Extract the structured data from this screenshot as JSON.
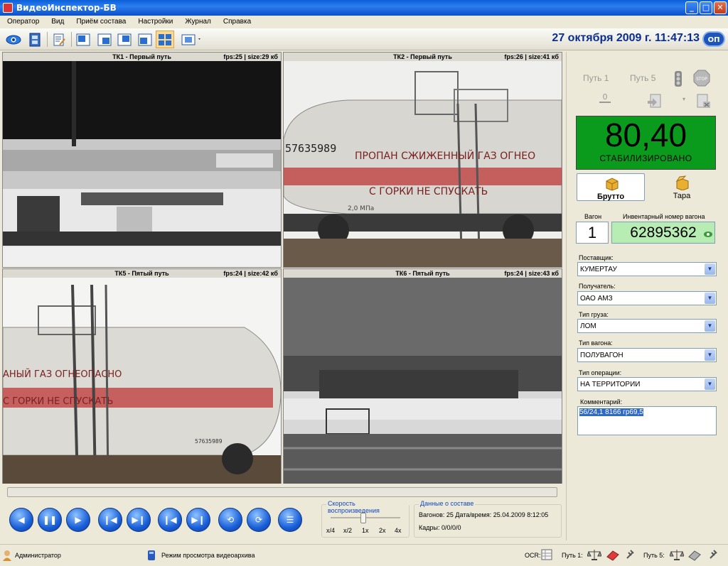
{
  "window": {
    "title": "ВидеоИнспектор-БВ"
  },
  "menu": [
    "Оператор",
    "Вид",
    "Приём состава",
    "Настройки",
    "Журнал",
    "Справка"
  ],
  "toolbar": {
    "buttons": [
      "eye-icon",
      "film-strip-icon",
      "document-edit-icon",
      "layout-1-icon",
      "layout-2-icon",
      "layout-3-icon",
      "layout-4-icon",
      "layout-grid-icon",
      "camera-select-icon"
    ],
    "datetime": "27 октября 2009 г. 11:47:13",
    "logo_text": "ОП"
  },
  "cameras": [
    {
      "title": "ТК1 - Первый путь",
      "fps": "fps:25 | size:29 кб"
    },
    {
      "title": "ТК2 - Первый путь",
      "fps": "fps:26 | size:41 кб"
    },
    {
      "title": "ТК5 - Пятый путь",
      "fps": "fps:24 | size:42 кб"
    },
    {
      "title": "ТК6 - Пятый путь",
      "fps": "fps:24 | size:43 кб"
    }
  ],
  "scene": {
    "tank_number": "57635989",
    "tank_text_1": "ПРОПАН СЖИЖЕННЫЙ ГАЗ ОГНЕО",
    "tank_text_2": "С ГОРКИ НЕ СПУСКАТЬ",
    "tank5_text_1": "АНЫЙ ГАЗ ОГНЕОПАСНО",
    "tank5_text_2": "С ГОРКИ НЕ СПУСКАТЬ",
    "tank5_number": "57635989",
    "side_label": "2,0 МПа"
  },
  "right": {
    "put1": "Путь 1",
    "put5": "Путь 5",
    "weight": "80,40",
    "status": "СТАБИЛИЗИРОВАНО",
    "brutto": "Брутто",
    "tara": "Тара",
    "wagon_label": "Вагон",
    "wagon_value": "1",
    "inv_label": "Инвентарный номер вагона",
    "inv_value": "62895362",
    "supplier_label": "Поставщик:",
    "supplier": "КУМЕРТАУ",
    "receiver_label": "Получатель:",
    "receiver": "ОАО АМЗ",
    "cargo_label": "Тип груза:",
    "cargo": "ЛОМ",
    "wagontype_label": "Тип вагона:",
    "wagontype": "ПОЛУВАГОН",
    "op_label": "Тип операции:",
    "op": "НА ТЕРРИТОРИИ",
    "comment_label": "Комментарий:",
    "comment": "56/24,1  8166  гр69,5"
  },
  "playback": {
    "speed_title": "Скорость воспроизведения",
    "speeds": [
      "x/4",
      "x/2",
      "1x",
      "2x",
      "4x"
    ],
    "speed_selected": "1x",
    "data_title": "Данные о составе",
    "wagons_label": "Вагонов:",
    "wagons_value": "25",
    "datetime_label": "Дата/время:",
    "datetime_value": "25.04.2009 8:12:05",
    "frames_label": "Кадры:",
    "frames_value": "0/0/0/0"
  },
  "status": {
    "user": "Администратор",
    "mode": "Режим просмотра видеоархива",
    "ocr_label": "OCR:",
    "put1_label": "Путь 1:",
    "put5_label": "Путь 5:"
  }
}
